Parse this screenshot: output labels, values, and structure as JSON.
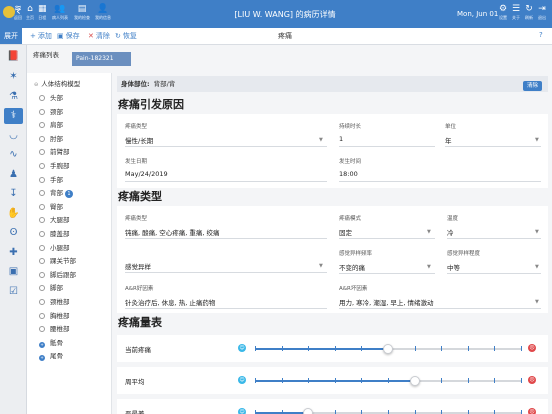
{
  "topbar": {
    "back_glyph": "‹",
    "items": [
      {
        "icon": "≋",
        "label": "返回"
      },
      {
        "icon": "⌂",
        "label": "主页"
      },
      {
        "icon": "▦",
        "label": "日程"
      },
      {
        "icon": "👥",
        "label": "病人列表"
      },
      {
        "icon": "▤",
        "label": "我的检查"
      },
      {
        "icon": "👤",
        "label": "我的信息"
      }
    ],
    "title": "[LIU W. WANG] 的病历详情",
    "date": "Mon, Jun 01",
    "right_items": [
      {
        "icon": "⚙",
        "label": "设置"
      },
      {
        "icon": "☰",
        "label": "关于"
      },
      {
        "icon": "↻",
        "label": "刷新"
      },
      {
        "icon": "⇥",
        "label": "退出"
      }
    ]
  },
  "bar2": {
    "expand": "展开",
    "add": "添加",
    "save": "保存",
    "delete": "清除",
    "restore": "恢复",
    "title": "疼痛",
    "help": "?"
  },
  "rail": {
    "icons": [
      "book-icon",
      "person-icon",
      "pill-icon",
      "stethoscope-icon",
      "tooth-icon",
      "pulse-icon",
      "body-icon",
      "syringe-icon",
      "hand-icon",
      "ear-icon",
      "plus-icon",
      "image-icon",
      "check-icon"
    ],
    "glyphs": [
      "📕",
      "✶",
      "⚗",
      "⚕",
      "◡",
      "∿",
      "♟",
      "↧",
      "✋",
      "ʘ",
      "✚",
      "▣",
      "☑"
    ]
  },
  "sub": {
    "list_label": "疼痛列表",
    "pain_item": "Pain-182321"
  },
  "tree": {
    "root": "人体结构模型",
    "items": [
      {
        "label": "头部",
        "badge": "",
        "plus": false
      },
      {
        "label": "颈部",
        "badge": "",
        "plus": false
      },
      {
        "label": "肩部",
        "badge": "",
        "plus": false
      },
      {
        "label": "肘部",
        "badge": "",
        "plus": false
      },
      {
        "label": "前臂部",
        "badge": "",
        "plus": false
      },
      {
        "label": "手腕部",
        "badge": "",
        "plus": false
      },
      {
        "label": "手部",
        "badge": "",
        "plus": false
      },
      {
        "label": "背部",
        "badge": "1",
        "plus": false
      },
      {
        "label": "臀部",
        "badge": "",
        "plus": false
      },
      {
        "label": "大腿部",
        "badge": "",
        "plus": false
      },
      {
        "label": "膝盖部",
        "badge": "",
        "plus": false
      },
      {
        "label": "小腿部",
        "badge": "",
        "plus": false
      },
      {
        "label": "踝关节部",
        "badge": "",
        "plus": false
      },
      {
        "label": "脚后跟部",
        "badge": "",
        "plus": false
      },
      {
        "label": "脚部",
        "badge": "",
        "plus": false
      },
      {
        "label": "颈椎部",
        "badge": "",
        "plus": false
      },
      {
        "label": "胸椎部",
        "badge": "",
        "plus": false
      },
      {
        "label": "腰椎部",
        "badge": "",
        "plus": false
      },
      {
        "label": "骶骨",
        "badge": "",
        "plus": true
      },
      {
        "label": "尾骨",
        "badge": "",
        "plus": true
      }
    ]
  },
  "main": {
    "body_part_label": "身体部位:",
    "body_part_value": "背部/背",
    "clear": "清除",
    "cause": {
      "title": "疼痛引发原因",
      "pain_type_label": "疼痛类型",
      "pain_type_value": "慢性/长期",
      "duration_label": "持续时长",
      "duration_value": "1",
      "unit_label": "单位",
      "unit_value": "年",
      "onset_date_label": "发生日期",
      "onset_date_value": "May/24/2019",
      "onset_time_label": "发生时间",
      "onset_time_value": "18:00"
    },
    "kind": {
      "title": "疼痛类型",
      "pain_type_label": "疼痛类型",
      "pain_type_value": "钝痛, 酸痛, 空心疼痛, 重痛, 绞痛",
      "pattern_label": "疼痛模式",
      "pattern_value": "固定",
      "temp_label": "温度",
      "temp_value": "冷",
      "abnormal_label": "感觉异样",
      "freq_label": "感觉异样频率",
      "freq_value": "不变的痛",
      "degree_label": "感觉异样程度",
      "degree_value": "中等",
      "relief_label": "A&R好因素",
      "relief_value": "针灸治疗后, 休息, 热, 止痛药物",
      "worse_label": "A&R坏因素",
      "worse_value": "用力, 寒冷, 潮湿, 早上, 情绪激动"
    },
    "scale": {
      "title": "疼痛量表",
      "rows": [
        {
          "label": "当前疼痛",
          "level": 0.5
        },
        {
          "label": "周平均",
          "level": 0.6
        },
        {
          "label": "严最差",
          "level": 0.2
        }
      ]
    }
  },
  "colors": {
    "accent": "#3f7fc7",
    "smile": "#3ab8e8",
    "sad": "#e0484a"
  }
}
